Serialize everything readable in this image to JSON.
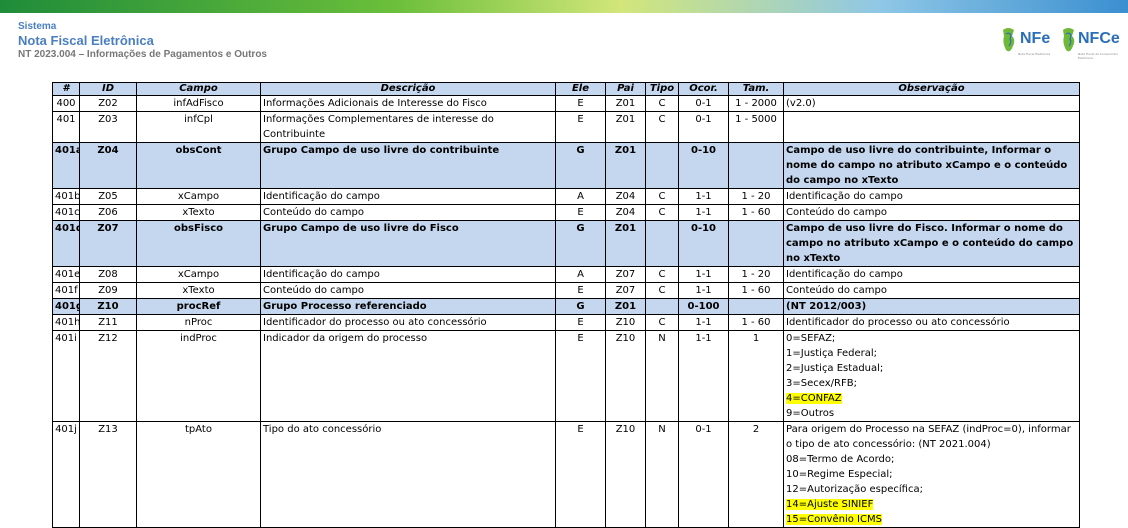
{
  "header": {
    "sistema": "Sistema",
    "title": "Nota Fiscal Eletrônica",
    "subtitle": "NT 2023.004 – Informações de Pagamentos e Outros"
  },
  "logos": [
    {
      "name": "NFe",
      "caption": "Nota Fiscal Eletrônica"
    },
    {
      "name": "NFCe",
      "caption": "Nota Fiscal de Consumidor Eletrônica"
    }
  ],
  "table": {
    "columns": [
      "#",
      "ID",
      "Campo",
      "Descrição",
      "Ele",
      "Pai",
      "Tipo",
      "Ocor.",
      "Tam.",
      "Observação"
    ],
    "rows": [
      {
        "num": "400",
        "id": "Z02",
        "campo": "infAdFisco",
        "desc": "Informações Adicionais de Interesse do Fisco",
        "ele": "E",
        "pai": "Z01",
        "tipo": "C",
        "ocor": "0-1",
        "tam": "1 - 2000",
        "obs": [
          "(v2.0)"
        ],
        "group": false
      },
      {
        "num": "401",
        "id": "Z03",
        "campo": "infCpl",
        "desc": "Informações Complementares de interesse do Contribuinte",
        "ele": "E",
        "pai": "Z01",
        "tipo": "C",
        "ocor": "0-1",
        "tam": "1 - 5000",
        "obs": [
          ""
        ],
        "group": false
      },
      {
        "num": "401a",
        "id": "Z04",
        "campo": "obsCont",
        "desc": "Grupo Campo de uso livre do contribuinte",
        "ele": "G",
        "pai": "Z01",
        "tipo": "",
        "ocor": "0-10",
        "tam": "",
        "obs": [
          "Campo de uso livre do contribuinte, Informar o nome do campo no atributo xCampo e o conteúdo do campo no xTexto"
        ],
        "group": true
      },
      {
        "num": "401b",
        "id": "Z05",
        "campo": "xCampo",
        "desc": "Identificação do campo",
        "ele": "A",
        "pai": "Z04",
        "tipo": "C",
        "ocor": "1-1",
        "tam": "1 - 20",
        "obs": [
          "Identificação do campo"
        ],
        "group": false
      },
      {
        "num": "401c",
        "id": "Z06",
        "campo": "xTexto",
        "desc": "Conteúdo do campo",
        "ele": "E",
        "pai": "Z04",
        "tipo": "C",
        "ocor": "1-1",
        "tam": "1 - 60",
        "obs": [
          "Conteúdo do campo"
        ],
        "group": false
      },
      {
        "num": "401d",
        "id": "Z07",
        "campo": "obsFisco",
        "desc": "Grupo Campo de uso livre do Fisco",
        "ele": "G",
        "pai": "Z01",
        "tipo": "",
        "ocor": "0-10",
        "tam": "",
        "obs": [
          "Campo de uso livre do Fisco. Informar o nome do campo no atributo xCampo e o conteúdo do campo no xTexto"
        ],
        "group": true
      },
      {
        "num": "401e",
        "id": "Z08",
        "campo": "xCampo",
        "desc": "Identificação do campo",
        "ele": "A",
        "pai": "Z07",
        "tipo": "C",
        "ocor": "1-1",
        "tam": "1 - 20",
        "obs": [
          "Identificação do campo"
        ],
        "group": false
      },
      {
        "num": "401f",
        "id": "Z09",
        "campo": "xTexto",
        "desc": "Conteúdo do campo",
        "ele": "E",
        "pai": "Z07",
        "tipo": "C",
        "ocor": "1-1",
        "tam": "1 - 60",
        "obs": [
          "Conteúdo do campo"
        ],
        "group": false
      },
      {
        "num": "401g",
        "id": "Z10",
        "campo": "procRef",
        "desc": "Grupo Processo referenciado",
        "ele": "G",
        "pai": "Z01",
        "tipo": "",
        "ocor": "0-100",
        "tam": "",
        "obs": [
          "(NT 2012/003)"
        ],
        "group": true
      },
      {
        "num": "401h",
        "id": "Z11",
        "campo": "nProc",
        "desc": "Identificador do processo ou ato concessório",
        "ele": "E",
        "pai": "Z10",
        "tipo": "C",
        "ocor": "1-1",
        "tam": "1 - 60",
        "obs": [
          "Identificador do processo ou ato concessório"
        ],
        "group": false
      },
      {
        "num": "401i",
        "id": "Z12",
        "campo": "indProc",
        "desc": "Indicador da origem do processo",
        "ele": "E",
        "pai": "Z10",
        "tipo": "N",
        "ocor": "1-1",
        "tam": "1",
        "obs": [
          "0=SEFAZ;",
          "1=Justiça Federal;",
          "2=Justiça Estadual;",
          "3=Secex/RFB;",
          "4=CONFAZ",
          "9=Outros"
        ],
        "hl": [
          4
        ],
        "group": false
      },
      {
        "num": "401j",
        "id": "Z13",
        "campo": "tpAto",
        "desc": "Tipo do ato concessório",
        "ele": "E",
        "pai": "Z10",
        "tipo": "N",
        "ocor": "0-1",
        "tam": "2",
        "obs": [
          "Para origem do Processo na SEFAZ (indProc=0), informar o tipo de ato concessório: (NT 2021.004)",
          "08=Termo de Acordo;",
          "10=Regime Especial;",
          "12=Autorização específica;",
          "14=Ajuste SINIEF",
          "15=Convênio ICMS"
        ],
        "hl": [
          4,
          5
        ],
        "group": false
      }
    ]
  }
}
